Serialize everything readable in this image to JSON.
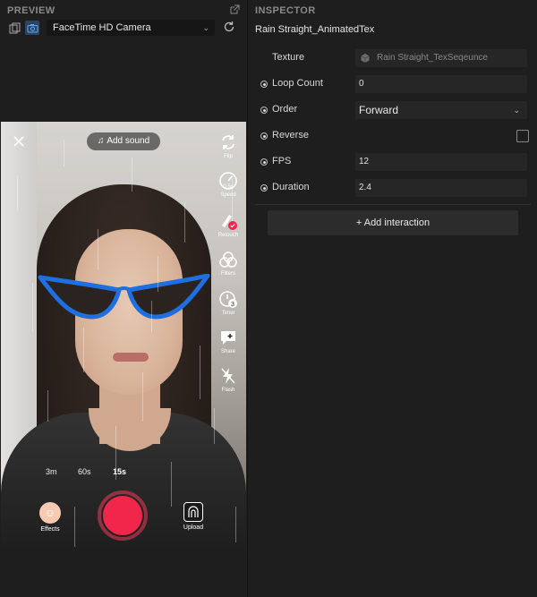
{
  "preview": {
    "title": "PREVIEW",
    "camera_select": "FaceTime HD Camera",
    "camera_ui": {
      "add_sound": "Add sound",
      "side_buttons": [
        {
          "label": "Flip",
          "icon": "flip-icon"
        },
        {
          "label": "Speed",
          "icon": "speed-icon",
          "badge": "0.5x"
        },
        {
          "label": "Retouch",
          "icon": "retouch-icon"
        },
        {
          "label": "Filters",
          "icon": "filters-icon"
        },
        {
          "label": "Timer",
          "icon": "timer-icon",
          "badge": "3"
        },
        {
          "label": "Share",
          "icon": "share-icon"
        },
        {
          "label": "Flash",
          "icon": "flash-icon"
        }
      ],
      "durations": [
        "3m",
        "60s",
        "15s"
      ],
      "effects_label": "Effects",
      "upload_label": "Upload"
    }
  },
  "inspector": {
    "title": "INSPECTOR",
    "asset_name": "Rain Straight_AnimatedTex",
    "properties": {
      "texture_label": "Texture",
      "texture_value": "Rain Straight_TexSeqeunce",
      "loop_count_label": "Loop Count",
      "loop_count_value": "0",
      "order_label": "Order",
      "order_value": "Forward",
      "reverse_label": "Reverse",
      "reverse_checked": false,
      "fps_label": "FPS",
      "fps_value": "12",
      "duration_label": "Duration",
      "duration_value": "2.4"
    },
    "add_interaction": "+ Add interaction"
  },
  "colors": {
    "background": "#1e1e1e",
    "field": "#262626",
    "record": "#f0274b",
    "glasses": "#1e6fe0"
  }
}
